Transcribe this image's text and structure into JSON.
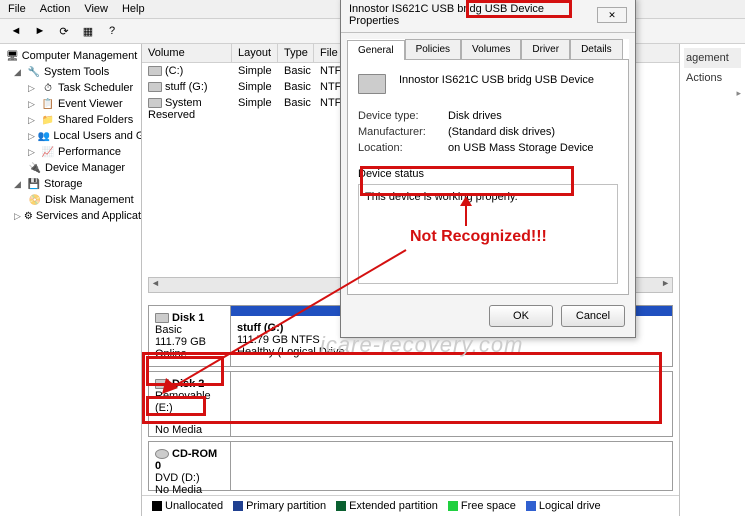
{
  "menu": {
    "file": "File",
    "action": "Action",
    "view": "View",
    "help": "Help"
  },
  "tree": {
    "root": "Computer Management (Local",
    "system_tools": "System Tools",
    "task_scheduler": "Task Scheduler",
    "event_viewer": "Event Viewer",
    "shared_folders": "Shared Folders",
    "local_users": "Local Users and Groups",
    "performance": "Performance",
    "device_manager": "Device Manager",
    "storage": "Storage",
    "disk_management": "Disk Management",
    "services_apps": "Services and Applications"
  },
  "grid": {
    "headers": {
      "volume": "Volume",
      "layout": "Layout",
      "type": "Type",
      "fsys": "File Sy"
    },
    "rows": [
      {
        "vol": "(C:)",
        "layout": "Simple",
        "type": "Basic",
        "fsys": "NTFS"
      },
      {
        "vol": "stuff (G:)",
        "layout": "Simple",
        "type": "Basic",
        "fsys": "NTFS"
      },
      {
        "vol": "System Reserved",
        "layout": "Simple",
        "type": "Basic",
        "fsys": "NTFS"
      }
    ]
  },
  "disks": {
    "disk1": {
      "name": "Disk 1",
      "kind": "Basic",
      "size": "111.79 GB",
      "status": "Online",
      "part_label": "stuff  (G:)",
      "part_info": "111.79 GB NTFS",
      "part_status": "Healthy (Logical Drive"
    },
    "disk2": {
      "name": "Disk 2",
      "kind": "Removable (E:)",
      "status": "No Media"
    },
    "cdrom": {
      "name": "CD-ROM 0",
      "kind": "DVD (D:)",
      "status": "No Media"
    }
  },
  "legend": {
    "unallocated": "Unallocated",
    "primary": "Primary partition",
    "extended": "Extended partition",
    "free": "Free space",
    "logical": "Logical drive"
  },
  "rightpane": {
    "agement": "agement",
    "actions": "Actions"
  },
  "dialog": {
    "title_left": "Innostor IS621C USB bridg USB",
    "title_right": "Device Properties",
    "tabs": {
      "general": "General",
      "policies": "Policies",
      "volumes": "Volumes",
      "driver": "Driver",
      "details": "Details"
    },
    "device_name": "Innostor IS621C USB bridg USB Device",
    "labels": {
      "type": "Device type:",
      "mfr": "Manufacturer:",
      "loc": "Location:"
    },
    "values": {
      "type": "Disk drives",
      "mfr": "(Standard disk drives)",
      "loc": "on USB Mass Storage Device"
    },
    "status_label": "Device status",
    "status_text": "This device is working properly.",
    "ok": "OK",
    "cancel": "Cancel"
  },
  "annotations": {
    "not_recognized": "Not Recognized!!!"
  },
  "watermark": "icare-recovery.com"
}
